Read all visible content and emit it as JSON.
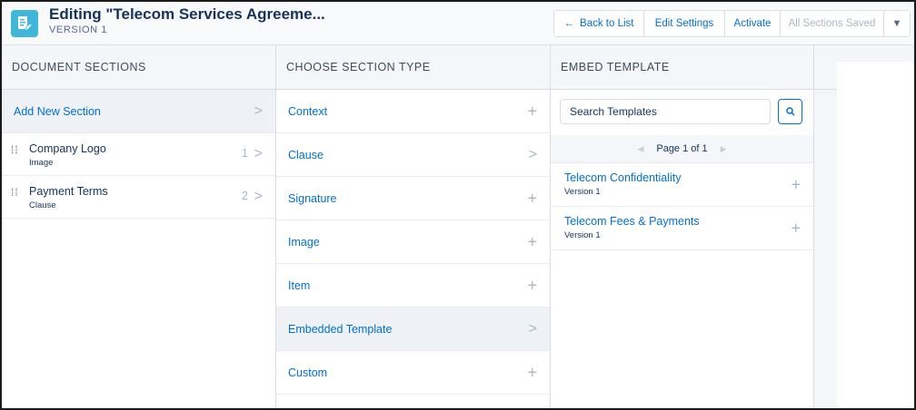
{
  "header": {
    "title": "Editing \"Telecom Services Agreeme...",
    "subtitle": "VERSION 1",
    "buttons": {
      "back": "Back to List",
      "edit": "Edit Settings",
      "activate": "Activate",
      "saved": "All Sections Saved"
    }
  },
  "columns": {
    "sections": "DOCUMENT SECTIONS",
    "types": "CHOOSE SECTION TYPE",
    "embed": "EMBED TEMPLATE"
  },
  "sections": {
    "add_label": "Add New Section",
    "items": [
      {
        "name": "Company Logo",
        "type": "Image",
        "num": "1"
      },
      {
        "name": "Payment Terms",
        "type": "Clause",
        "num": "2"
      }
    ]
  },
  "section_types": [
    {
      "label": "Context",
      "action": "plus"
    },
    {
      "label": "Clause",
      "action": "chevron"
    },
    {
      "label": "Signature",
      "action": "plus"
    },
    {
      "label": "Image",
      "action": "plus"
    },
    {
      "label": "Item",
      "action": "plus"
    },
    {
      "label": "Embedded Template",
      "action": "chevron"
    },
    {
      "label": "Custom",
      "action": "plus"
    }
  ],
  "embed": {
    "search_placeholder": "Search Templates",
    "pager": "Page 1 of 1",
    "templates": [
      {
        "name": "Telecom Confidentiality",
        "version": "Version 1"
      },
      {
        "name": "Telecom Fees & Payments",
        "version": "Version 1"
      }
    ]
  },
  "colors": {
    "accent": "#0070d2",
    "icon_bg": "#40b6d9",
    "header_bg": "#f7f9fb"
  }
}
